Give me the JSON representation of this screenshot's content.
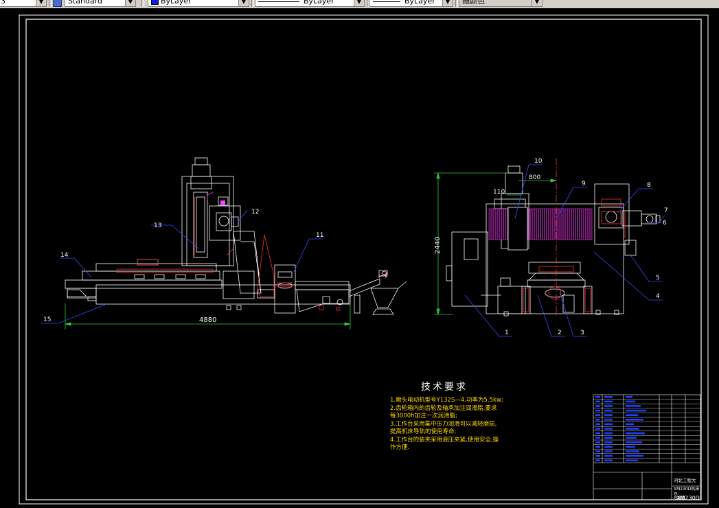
{
  "toolbar": {
    "text_style": "Standard",
    "layer_color": "ByLayer",
    "linetype": "ByLayer",
    "lineweight": "ByLayer",
    "plot_style": "随颜色",
    "left_fragment": "3",
    "colors": {
      "layer_swatch": "#1020e0"
    }
  },
  "drawing": {
    "dimensions": {
      "base_length": "4880",
      "total_height": "2440",
      "head_offset": "800",
      "small_offset": "110"
    },
    "part_numbers": [
      "1",
      "2",
      "3",
      "4",
      "5",
      "6",
      "7",
      "8",
      "9",
      "10",
      "11",
      "12",
      "13",
      "14",
      "15"
    ],
    "tech_title": "技术要求",
    "tech_notes": [
      "1.磨头电动机型号Y132S—4,功率为5.5kw;",
      "2.齿轮箱内的齿轮及轴承加注润滑脂,要求",
      "每3000h加注一次润滑脂;",
      "3.工作台采用集中压力润滑可以减轻磨损,",
      "提高机床导轨的使用寿命;",
      "4.工作台的装夹采用液压夹紧,使用安全,操",
      "作方便."
    ],
    "title_block": {
      "school": "河北工程大",
      "drawing_name": "XM230D机床",
      "sub": "总",
      "sub2": "总装图",
      "code": "XM230D"
    }
  }
}
